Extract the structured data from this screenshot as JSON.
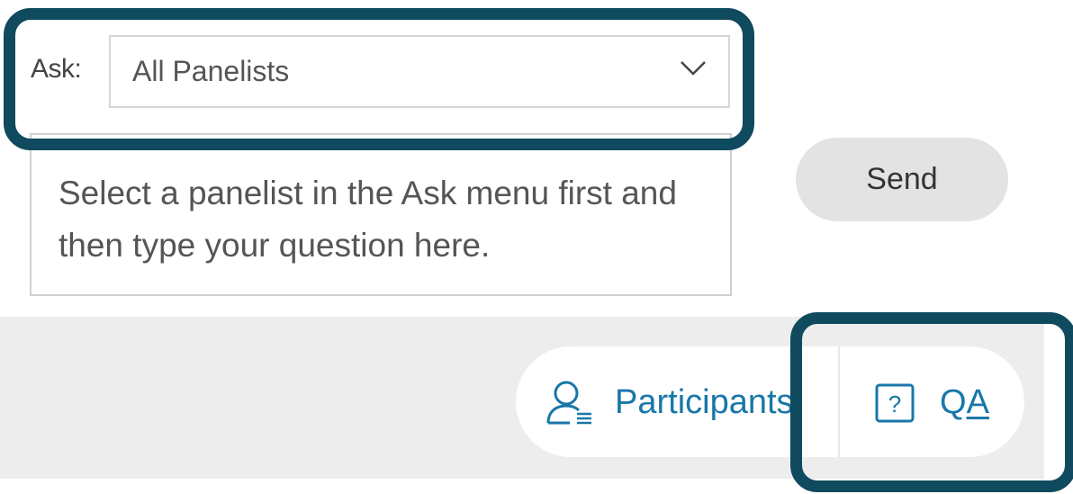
{
  "ask": {
    "label": "Ask:",
    "selected": "All Panelists",
    "chevron_icon": "chevron-down-icon"
  },
  "question": {
    "placeholder": "Select a panelist in the Ask menu first and then type your question here."
  },
  "send": {
    "label": "Send"
  },
  "bottom_bar": {
    "participants": {
      "label": "Participants",
      "icon": "participants-icon"
    },
    "qa": {
      "label_prefix": "Q",
      "label_underlined": "A",
      "icon": "question-box-icon"
    }
  },
  "colors": {
    "accent": "#1877a8",
    "highlight": "#0f4a5e",
    "bar_background": "#ededed",
    "send_background": "#e3e3e3"
  }
}
